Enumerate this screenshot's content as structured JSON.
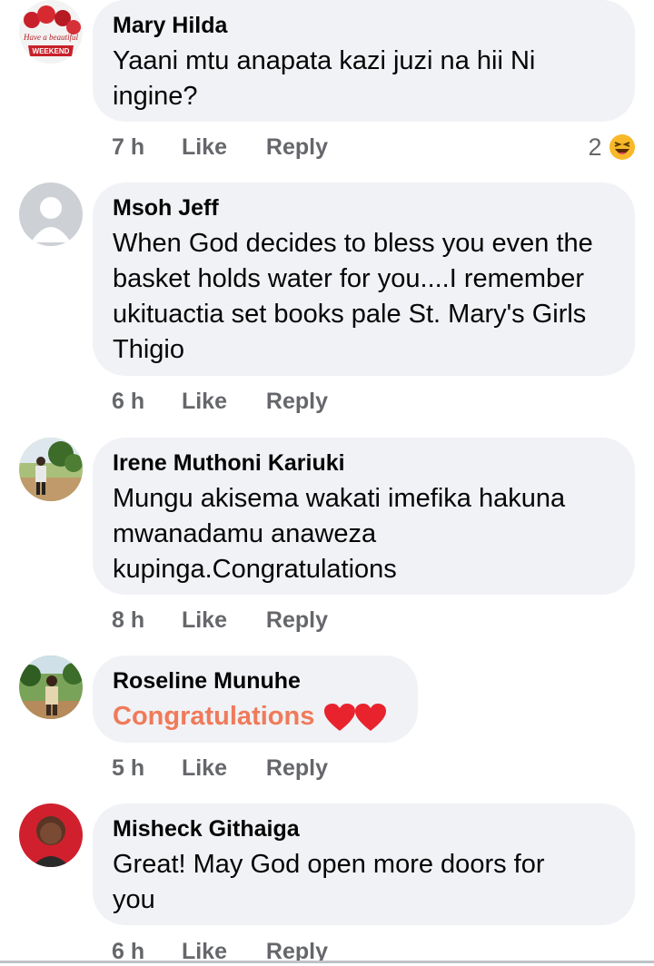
{
  "comments": [
    {
      "name": "Mary Hilda",
      "text": "Yaani mtu anapata kazi juzi na hii Ni ingine?",
      "time": "7 h",
      "like": "Like",
      "reply": "Reply",
      "reaction_count": "2",
      "avatar_text_1": "Have a beautiful",
      "avatar_text_2": "WEEKEND"
    },
    {
      "name": "Msoh Jeff",
      "text": "When God decides to bless you even the basket holds water for you....I remember ukituactia set books pale St. Mary's Girls Thigio",
      "time": "6 h",
      "like": "Like",
      "reply": "Reply"
    },
    {
      "name": "Irene Muthoni Kariuki",
      "text": "Mungu akisema wakati imefika hakuna mwanadamu anaweza kupinga.Congratulations",
      "time": "8 h",
      "like": "Like",
      "reply": "Reply"
    },
    {
      "name": "Roseline Munuhe",
      "text": "Congratulations",
      "time": "5 h",
      "like": "Like",
      "reply": "Reply"
    },
    {
      "name": "Misheck Githaiga",
      "text": "Great! May God open more doors for you",
      "time": "6 h",
      "like": "Like",
      "reply": "Reply"
    }
  ],
  "colors": {
    "bubble": "#f0f2f5",
    "meta": "#65676b",
    "congrats": "#f07a5a",
    "heart": "#e8232d"
  },
  "icons": {
    "reaction": "laughing-emoji-icon",
    "heart": "heart-icon"
  }
}
